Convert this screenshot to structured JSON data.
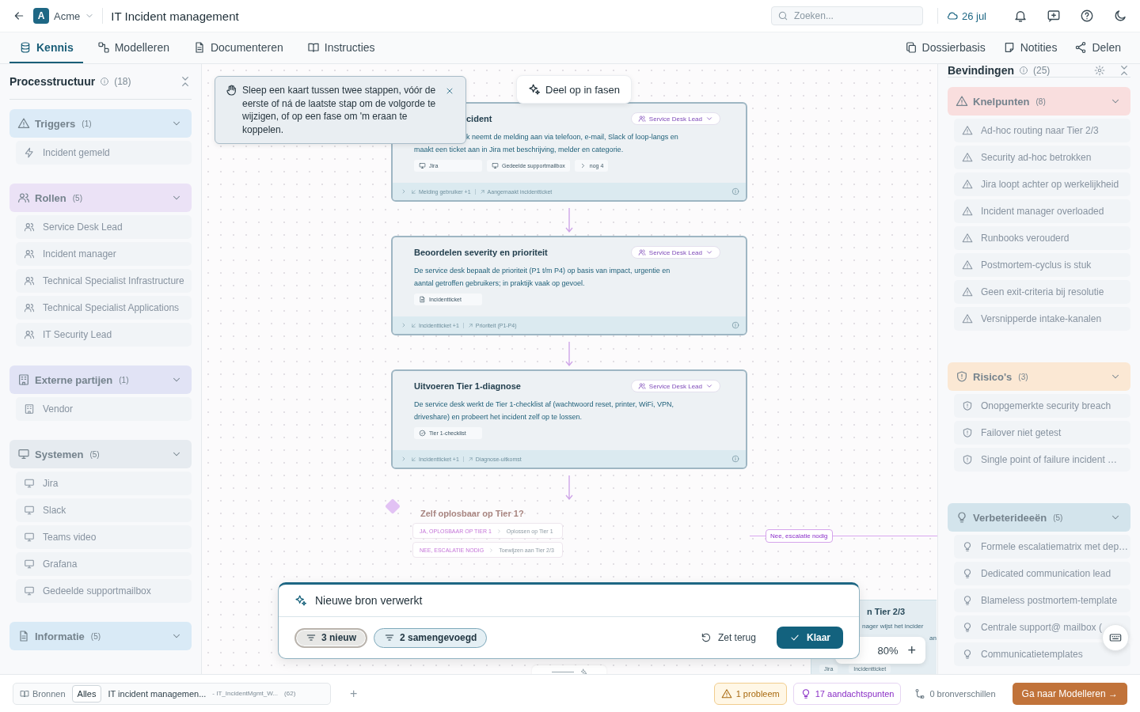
{
  "header": {
    "workspace_initial": "A",
    "workspace": "Acme",
    "title": "IT Incident management",
    "search": {
      "placeholder": "Zoeken..."
    },
    "date": "26 jul"
  },
  "tabs": [
    {
      "label": "Kennis",
      "selected": true
    },
    {
      "label": "Modelleren",
      "selected": false
    },
    {
      "label": "Documenteren",
      "selected": false
    },
    {
      "label": "Instructies",
      "selected": false
    }
  ],
  "tab_actions": [
    "Dossierbasis",
    "Notities",
    "Delen"
  ],
  "left_panel": {
    "title": "Processtructuur",
    "count": "(18)",
    "dimmed": true,
    "groups": [
      {
        "kind": "trigger",
        "label": "Triggers",
        "count": "(1)",
        "color": "#dcebf7",
        "items": [
          "Incident gemeld"
        ]
      },
      {
        "kind": "role",
        "label": "Rollen",
        "count": "(5)",
        "color": "#ebe2f6",
        "items": [
          "Service Desk Lead",
          "Incident manager",
          "Technical Specialist Infrastructure",
          "Technical Specialist Applications",
          "IT Security Lead"
        ]
      },
      {
        "kind": "external",
        "label": "Externe partijen",
        "count": "(1)",
        "color": "#e1e3f5",
        "items": [
          "Vendor"
        ]
      },
      {
        "kind": "system",
        "label": "Systemen",
        "count": "(5)",
        "color": "#e6ebf0",
        "items": [
          "Jira",
          "Slack",
          "Teams video",
          "Grafana",
          "Gedeelde supportmailbox"
        ]
      },
      {
        "kind": "info",
        "label": "Informatie",
        "count": "(5)",
        "color": "#d9eaf6"
      }
    ]
  },
  "canvas": {
    "hint": "Sleep een kaart tussen twee stappen, vóór de eerste of ná de laatste stap om de volgorde te wijzigen, of op een fase om 'm eraan te koppelen.",
    "phase_button": "Deel op in fasen",
    "steps": [
      {
        "title": "cident",
        "partly_hidden": true,
        "role": "Service Desk Lead",
        "lines": [
          "k neemt de melding aan via telefoon, e-mail, Slack of loop-langs en",
          "maakt een ticket aan in Jira met beschrijving, melder en categorie."
        ],
        "tags": [
          {
            "kind": "system",
            "label": "Jira"
          },
          {
            "kind": "system",
            "label": "Gedeelde supportmailbox"
          },
          {
            "kind": "more",
            "label": "nog 4"
          }
        ],
        "input": "Melding gebruiker +1",
        "output": "Aangemaakt incidentticket"
      },
      {
        "title": "Beoordelen severity en prioriteit",
        "partly_hidden": false,
        "role": "Service Desk Lead",
        "lines": [
          "De service desk bepaalt de prioriteit (P1 t/m P4) op basis van impact, urgentie en",
          "aantal getroffen gebruikers; in praktijk vaak op gevoel."
        ],
        "tags": [
          {
            "kind": "document",
            "label": "Incidentticket"
          }
        ],
        "input": "Incidentticket +1",
        "output": "Prioriteit (P1-P4)"
      },
      {
        "title": "Uitvoeren Tier 1-diagnose",
        "partly_hidden": false,
        "role": "Service Desk Lead",
        "lines": [
          "De service desk werkt de Tier 1-checklist af (wachtwoord reset, printer, WiFi, VPN,",
          "driveshare) en probeert het incident zelf op te lossen."
        ],
        "tags": [
          {
            "kind": "checklist",
            "label": "Tier 1-checklist"
          }
        ],
        "input": "Incidentticket +1",
        "output": "Diagnose-uitkomst"
      }
    ],
    "decision": {
      "title": "Zelf oplosbaar op Tier 1?",
      "options": [
        {
          "label": "JA, OPLOSBAAR OP TIER 1",
          "target": "Oplossen op Tier 1"
        },
        {
          "label": "NEE, ESCALATIE NODIG",
          "target": "Toewijzen aan Tier 2/3"
        }
      ]
    },
    "edge_label": "Nee, escalatie nodig",
    "partial_step": {
      "title": "n Tier 2/3",
      "lines": [
        "nager wijst het incider",
        "an"
      ],
      "tags": [
        "Jira",
        "Incidentticket"
      ]
    },
    "zoom": "80%",
    "zoom_in": "+"
  },
  "popup": {
    "title": "Nieuwe bron verwerkt",
    "chips": [
      {
        "label": "3 nieuw",
        "selected": true
      },
      {
        "label": "2 samengevoegd",
        "selected": false
      }
    ],
    "reset": "Zet terug",
    "done": "Klaar"
  },
  "right_panel": {
    "title": "Bevindingen",
    "count": "(25)",
    "dimmed": true,
    "groups": [
      {
        "kind": "bottleneck",
        "label": "Knelpunten",
        "count": "(8)",
        "color": "#f9dede",
        "items": [
          "Ad-hoc routing naar Tier 2/3",
          "Security ad-hoc betrokken",
          "Jira loopt achter op werkelijkheid",
          "Incident manager overloaded",
          "Runbooks verouderd",
          "Postmortem-cyclus is stuk",
          "Geen exit-criteria bij resolutie",
          "Versnipperde intake-kanalen"
        ]
      },
      {
        "kind": "risk",
        "label": "Risico's",
        "count": "(3)",
        "color": "#fbe8d4",
        "items": [
          "Onopgemerkte security breach",
          "Failover niet getest",
          "Single point of failure incident …"
        ]
      },
      {
        "kind": "idea",
        "label": "Verbeterideeën",
        "count": "(5)",
        "color": "#d3e4ec",
        "items": [
          "Formele escalatiematrix met dep…",
          "Dedicated communication lead",
          "Blameless postmortem-template",
          "Centrale support@ mailbox (",
          "Communicatietemplates"
        ]
      }
    ]
  },
  "bottom_bar": {
    "sources": "Bronnen",
    "filter": {
      "label": "Alles",
      "selected": true
    },
    "source": "IT incident managemen...",
    "file": "- IT_IncidentMgmt_W...",
    "file_count": "(62)",
    "add": "+",
    "status": [
      {
        "kind": "problem",
        "label": "1 probleem"
      },
      {
        "kind": "attention",
        "label": "17 aandachtspunten"
      },
      {
        "kind": "diff",
        "label": "0 bronverschillen"
      }
    ],
    "next": "Ga naar Modelleren →"
  }
}
